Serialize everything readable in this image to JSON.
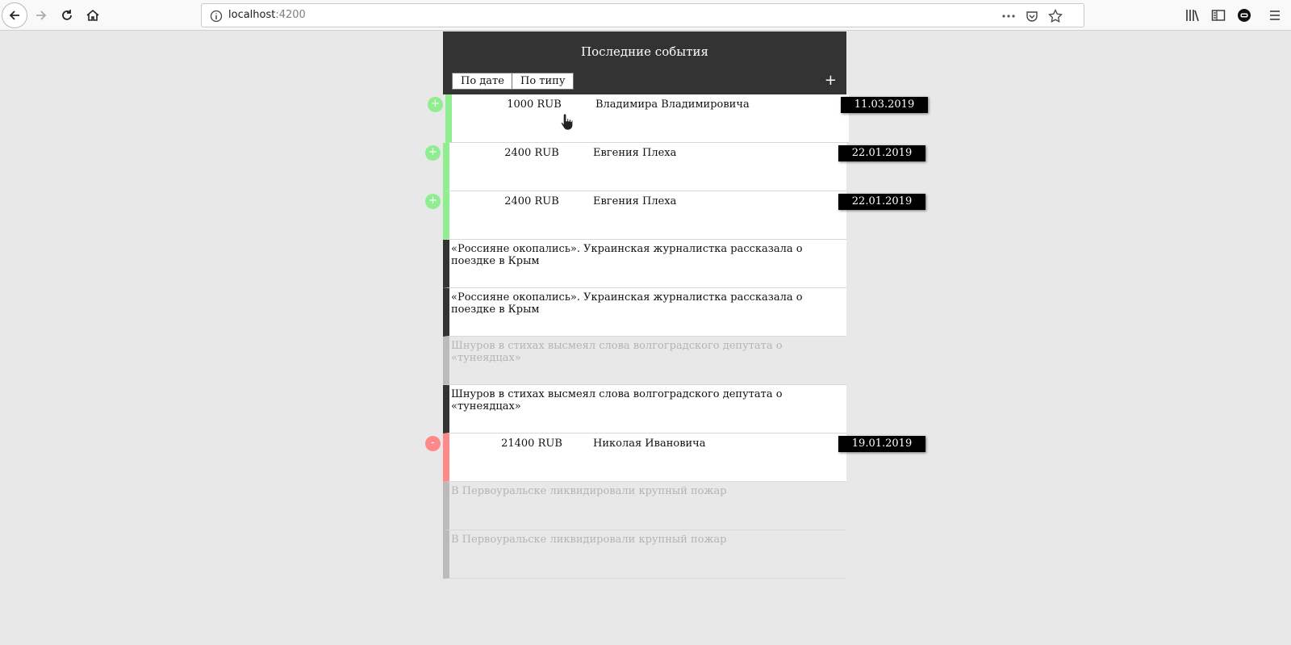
{
  "browser": {
    "url_host": "localhost",
    "url_port": ":4200"
  },
  "app": {
    "title": "Последние события",
    "sort_by_date": "По дате",
    "sort_by_type": "По типу",
    "add_label": "+"
  },
  "events": [
    {
      "kind": "income",
      "icon": "+",
      "amount": "1000 RUB",
      "person": "Владимира Владимировича",
      "date": "11.03.2019"
    },
    {
      "kind": "income",
      "icon": "+",
      "amount": "2400 RUB",
      "person": "Евгения Плеха",
      "date": "22.01.2019"
    },
    {
      "kind": "income",
      "icon": "+",
      "amount": "2400 RUB",
      "person": "Евгения Плеха",
      "date": "22.01.2019"
    },
    {
      "kind": "news",
      "read": false,
      "text": "«Россияне окопались». Украинская журналистка рассказала о поездке в Крым"
    },
    {
      "kind": "news",
      "read": false,
      "text": "«Россияне окопались». Украинская журналистка рассказала о поездке в Крым"
    },
    {
      "kind": "news",
      "read": true,
      "text": "Шнуров в стихах высмеял слова волгоградского депутата о «тунеядцах»"
    },
    {
      "kind": "news",
      "read": false,
      "text": "Шнуров в стихах высмеял слова волгоградского депутата о «тунеядцах»"
    },
    {
      "kind": "expense",
      "icon": "-",
      "amount": "21400 RUB",
      "person": "Николая Ивановича",
      "date": "19.01.2019"
    },
    {
      "kind": "news",
      "read": true,
      "text": "В Первоуральске ликвидировали крупный пожар"
    },
    {
      "kind": "news",
      "read": true,
      "text": "В Первоуральске ликвидировали крупный пожар"
    }
  ],
  "colors": {
    "header_bg": "#333333",
    "income": "#90ee90",
    "expense": "#ff8888",
    "read_bg": "#e8e8e8",
    "page_bg": "#e8e8e8"
  }
}
